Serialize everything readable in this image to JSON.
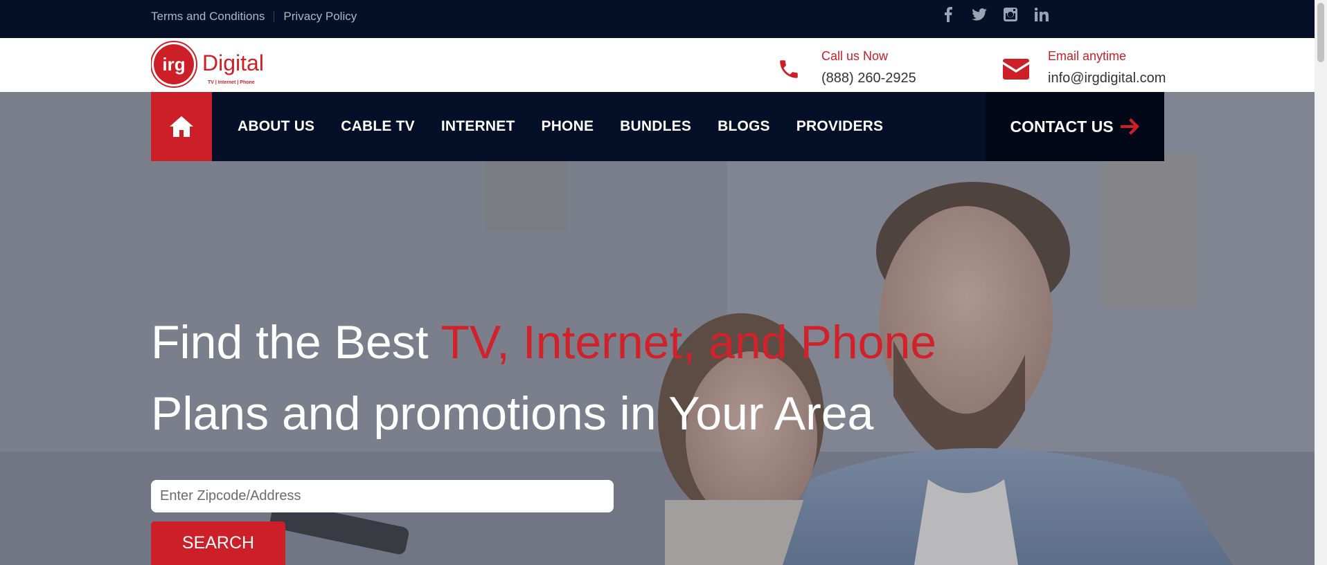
{
  "topbar": {
    "links": [
      "Terms and Conditions",
      "Privacy Policy"
    ],
    "social_icons": [
      "facebook-icon",
      "twitter-icon",
      "instagram-icon",
      "linkedin-icon"
    ]
  },
  "header": {
    "logo": {
      "mark": "irg",
      "word": "Digital",
      "tagline": "TV | Internet | Phone"
    },
    "call": {
      "label": "Call us Now",
      "value": "(888) 260-2925",
      "icon": "phone-icon"
    },
    "email": {
      "label": "Email anytime",
      "value": "info@irgdigital.com",
      "icon": "envelope-icon"
    }
  },
  "nav": {
    "home_icon": "home-icon",
    "items": [
      "ABOUT US",
      "CABLE TV",
      "INTERNET",
      "PHONE",
      "BUNDLES",
      "BLOGS",
      "PROVIDERS"
    ],
    "cta": "CONTACT US",
    "cta_icon": "arrow-right-icon"
  },
  "hero": {
    "line1_prefix": "Find the Best ",
    "line1_highlight": "TV, Internet, and Phone",
    "line2": "Plans and promotions in Your Area",
    "search_placeholder": "Enter Zipcode/Address",
    "search_button": "SEARCH"
  },
  "colors": {
    "brand_red": "#cc1f27",
    "navy": "#050f28"
  }
}
